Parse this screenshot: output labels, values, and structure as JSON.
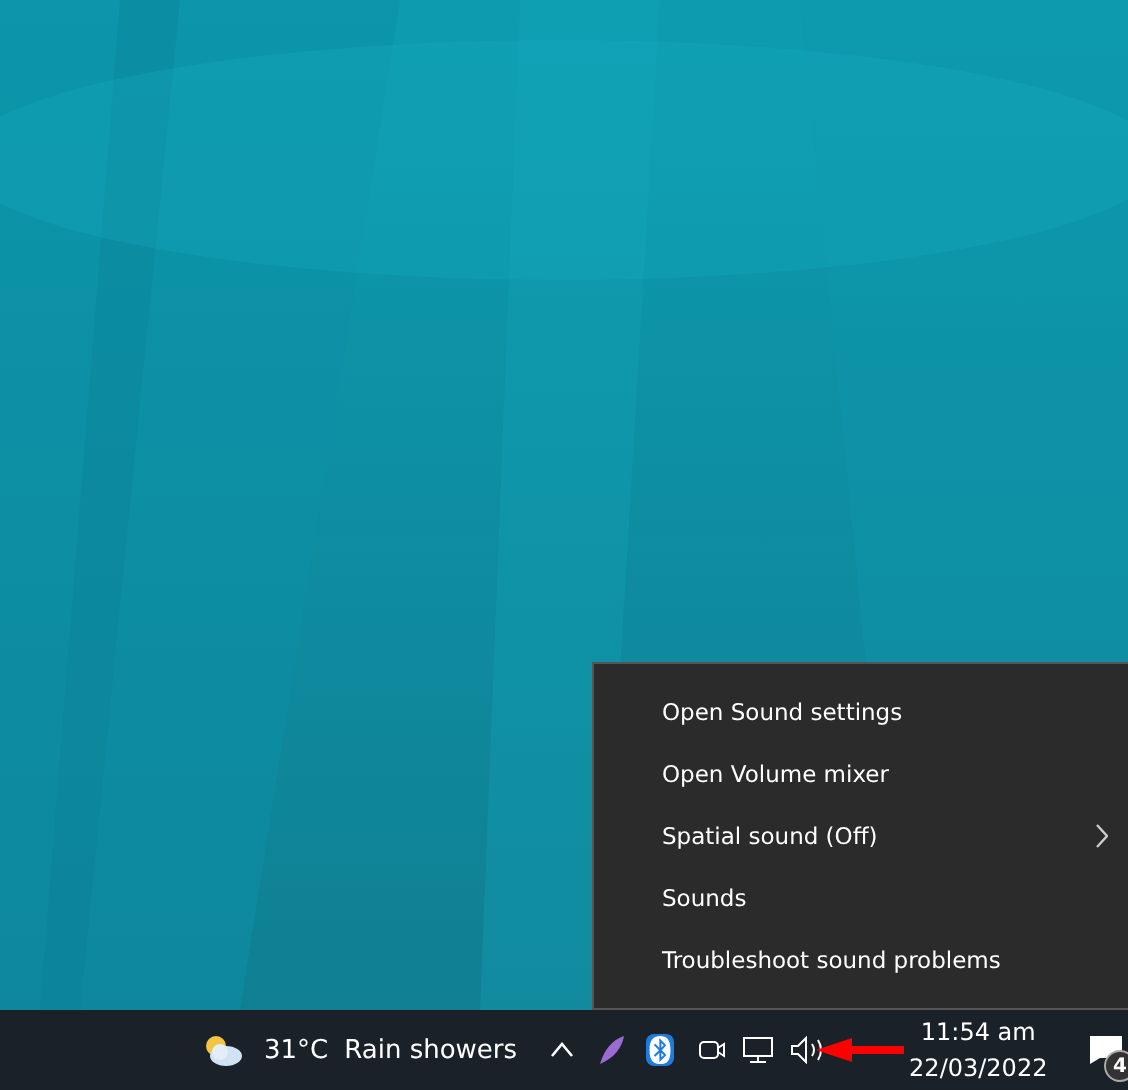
{
  "context_menu": {
    "items": [
      {
        "label": "Open Sound settings",
        "has_submenu": false
      },
      {
        "label": "Open Volume mixer",
        "has_submenu": false
      },
      {
        "label": "Spatial sound (Off)",
        "has_submenu": true
      },
      {
        "label": "Sounds",
        "has_submenu": false
      },
      {
        "label": "Troubleshoot sound problems",
        "has_submenu": false
      }
    ]
  },
  "taskbar": {
    "weather": {
      "temperature": "31°C",
      "condition": "Rain showers"
    },
    "clock": {
      "time": "11:54 am",
      "date": "22/03/2022"
    },
    "notifications": {
      "count": "4"
    }
  }
}
